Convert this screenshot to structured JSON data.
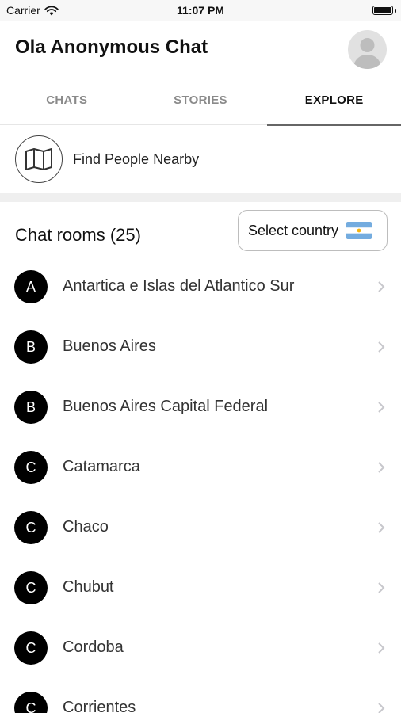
{
  "status_bar": {
    "carrier": "Carrier",
    "time": "11:07 PM",
    "wifi_icon": "wifi-icon",
    "battery_icon": "battery-icon"
  },
  "header": {
    "title": "Ola Anonymous Chat",
    "avatar_icon": "user-avatar-icon"
  },
  "tabs": [
    {
      "label": "CHATS",
      "active": false
    },
    {
      "label": "STORIES",
      "active": false
    },
    {
      "label": "EXPLORE",
      "active": true
    }
  ],
  "nearby": {
    "label": "Find People Nearby",
    "icon": "map-icon"
  },
  "rooms": {
    "title": "Chat rooms (25)",
    "select_country_label": "Select country",
    "flag_icon": "argentina-flag-icon",
    "items": [
      {
        "letter": "A",
        "name": "Antartica e Islas del Atlantico Sur"
      },
      {
        "letter": "B",
        "name": "Buenos Aires"
      },
      {
        "letter": "B",
        "name": "Buenos Aires Capital Federal"
      },
      {
        "letter": "C",
        "name": "Catamarca"
      },
      {
        "letter": "C",
        "name": "Chaco"
      },
      {
        "letter": "C",
        "name": "Chubut"
      },
      {
        "letter": "C",
        "name": "Cordoba"
      },
      {
        "letter": "C",
        "name": "Corrientes"
      }
    ]
  },
  "colors": {
    "accent_active_tab": "#111111",
    "inactive_tab": "#8a8a8a",
    "room_avatar_bg": "#000000",
    "separator": "#efefef"
  }
}
